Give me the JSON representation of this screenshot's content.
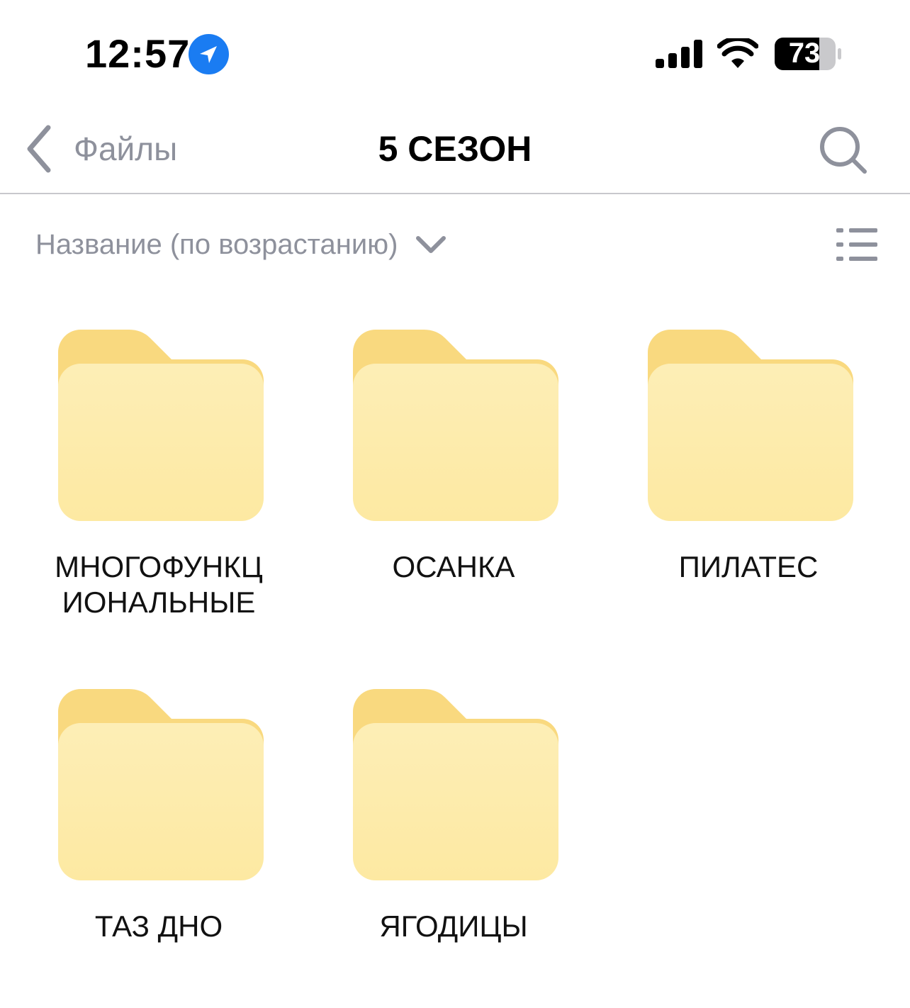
{
  "status_bar": {
    "time": "12:57",
    "battery_level": "73",
    "icons": [
      "location-arrow-icon",
      "cellular-signal-icon",
      "wifi-icon",
      "battery-icon"
    ]
  },
  "nav": {
    "back_label": "Файлы",
    "title": "5 СЕЗОН",
    "icons": [
      "chevron-left-icon",
      "search-icon"
    ]
  },
  "sort": {
    "label": "Название (по возрастанию)",
    "icons": [
      "chevron-down-icon",
      "list-view-icon"
    ]
  },
  "folders": [
    {
      "name": "МНОГОФУНКЦИОНАЛЬНЫЕ"
    },
    {
      "name": "ОСАНКА"
    },
    {
      "name": "ПИЛАТЕС"
    },
    {
      "name": "ТАЗ ДНО"
    },
    {
      "name": "ЯГОДИЦЫ"
    }
  ],
  "colors": {
    "accent_blue": "#1a7cf2",
    "secondary_text": "#8e919c",
    "folder_front": "#fdeaa8",
    "folder_back": "#f9d97f"
  }
}
